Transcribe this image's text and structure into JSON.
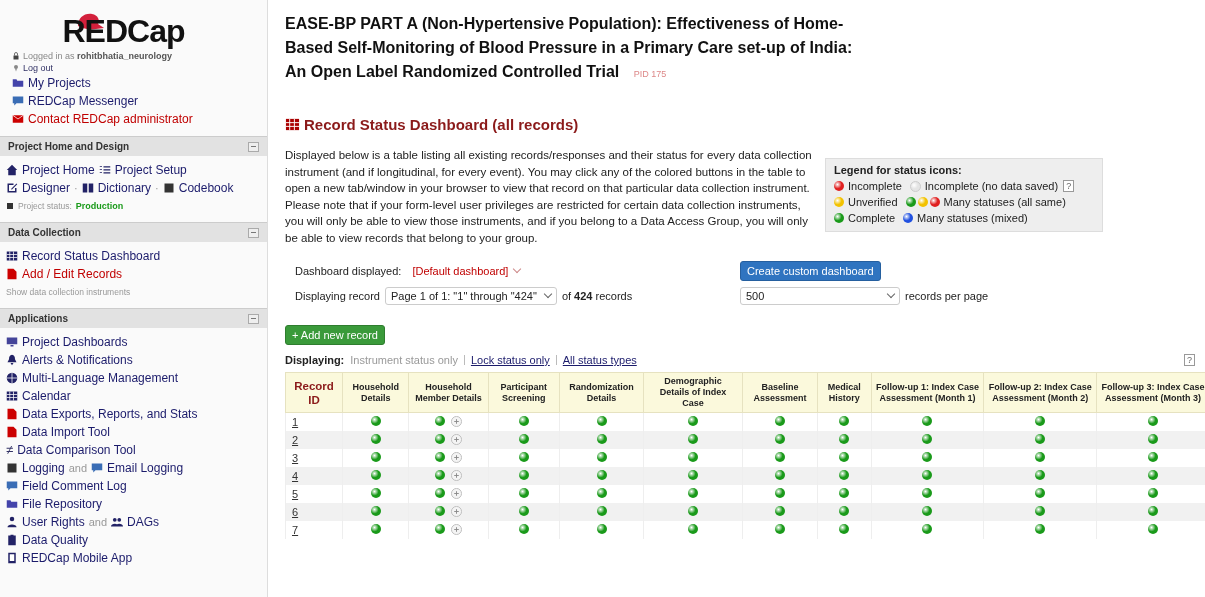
{
  "sidebar": {
    "logo": "REDCap",
    "login": {
      "prefix": "Logged in as",
      "user": "rohitbhatia_neurology",
      "logout": "Log out"
    },
    "links": [
      {
        "label": "My Projects",
        "kind": "link"
      },
      {
        "label": "REDCap Messenger",
        "kind": "link"
      },
      {
        "label": "Contact REDCap administrator",
        "kind": "red-link"
      }
    ],
    "sections": [
      {
        "title": "Project Home and Design",
        "expanded": true,
        "rows": [
          [
            {
              "label": "Project Home",
              "kind": "link"
            },
            {
              "label": "Project Setup",
              "kind": "link"
            }
          ],
          [
            {
              "label": "Designer",
              "kind": "link"
            },
            {
              "label": "·",
              "kind": "text"
            },
            {
              "label": "Dictionary",
              "kind": "link"
            },
            {
              "label": "·",
              "kind": "text"
            },
            {
              "label": "Codebook",
              "kind": "link"
            }
          ],
          [
            {
              "label": "Project status:",
              "kind": "note"
            },
            {
              "label": "Production",
              "kind": "status"
            }
          ]
        ]
      },
      {
        "title": "Data Collection",
        "expanded": true,
        "rows": [
          [
            {
              "label": "Record Status Dashboard",
              "kind": "link"
            }
          ],
          [
            {
              "label": "Add / Edit Records",
              "kind": "red-link"
            }
          ],
          [
            {
              "label": "Show data collection instruments",
              "kind": "note"
            }
          ]
        ]
      },
      {
        "title": "Applications",
        "expanded": true,
        "rows": [
          [
            {
              "label": "Project Dashboards",
              "kind": "link"
            }
          ],
          [
            {
              "label": "Alerts & Notifications",
              "kind": "link"
            }
          ],
          [
            {
              "label": "Multi-Language Management",
              "kind": "link"
            }
          ],
          [
            {
              "label": "Calendar",
              "kind": "link"
            }
          ],
          [
            {
              "label": "Data Exports, Reports, and Stats",
              "kind": "link"
            }
          ],
          [
            {
              "label": "Data Import Tool",
              "kind": "link"
            }
          ],
          [
            {
              "label": "≠",
              "kind": "glyph"
            },
            {
              "label": "Data Comparison Tool",
              "kind": "link"
            }
          ],
          [
            {
              "label": "Logging",
              "kind": "link"
            },
            {
              "label": "and",
              "kind": "text"
            },
            {
              "label": "Email Logging",
              "kind": "link"
            }
          ],
          [
            {
              "label": "Field Comment Log",
              "kind": "link"
            }
          ],
          [
            {
              "label": "File Repository",
              "kind": "link"
            }
          ],
          [
            {
              "label": "User Rights",
              "kind": "link"
            },
            {
              "label": "and",
              "kind": "text"
            },
            {
              "label": "DAGs",
              "kind": "link"
            }
          ],
          [
            {
              "label": "Data Quality",
              "kind": "link"
            }
          ],
          [
            {
              "label": "REDCap Mobile App",
              "kind": "link"
            }
          ]
        ]
      }
    ]
  },
  "project": {
    "title": "EASE-BP PART A (Non-Hypertensive Population): Effectiveness of Home-Based Self-Monitoring of Blood Pressure in a Primary Care set-up of India: An Open Label Randomized Controlled Trial",
    "pid": "PID 175"
  },
  "page_heading": "Record Status Dashboard (all records)",
  "description": "Displayed below is a table listing all existing records/responses and their status for every data collection instrument (and if longitudinal, for every event). You may click any of the colored buttons in the table to open a new tab/window in your browser to view that record on that particular data collection instrument. Please note that if your form-level user privileges are restricted for certain data collection instruments, you will only be able to view those instruments, and if you belong to a Data Access Group, you will only be able to view records that belong to your group.",
  "legend": {
    "title": "Legend for status icons:",
    "rows": [
      [
        {
          "statuses": [
            {
              "kind": "incomplete"
            }
          ],
          "label": "Incomplete"
        },
        {
          "statuses": [
            {
              "kind": "empty"
            }
          ],
          "label": "Incomplete (no data saved)",
          "help": "?"
        }
      ],
      [
        {
          "statuses": [
            {
              "kind": "unverified"
            }
          ],
          "label": "Unverified"
        },
        {
          "statuses": [
            {
              "kind": "complete"
            },
            {
              "kind": "unverified"
            },
            {
              "kind": "incomplete"
            }
          ],
          "label": "Many statuses (all same)"
        }
      ],
      [
        {
          "statuses": [
            {
              "kind": "complete"
            }
          ],
          "label": "Complete"
        },
        {
          "statuses": [
            {
              "kind": "mixed"
            }
          ],
          "label": "Many statuses (mixed)"
        }
      ]
    ]
  },
  "controls": {
    "dashboard_label": "Dashboard displayed:",
    "dashboard_select": "[Default dashboard]",
    "create_button": "Create custom dashboard",
    "record_label": "Displaying record",
    "page_select": "Page 1 of 1: \"1\" through \"424\"",
    "record_count": "of **424** records",
    "per_page_select": "500",
    "per_page_label": "records per page"
  },
  "add_button": "+ Add new record",
  "display": {
    "label": "Displaying:",
    "options": [
      {
        "label": "Instrument status only",
        "selected": true
      },
      {
        "label": "Lock status only",
        "selected": false
      },
      {
        "label": "All status types",
        "selected": false
      }
    ],
    "help": "?"
  },
  "table": {
    "columns": [
      {
        "label": "Record ID",
        "kind": "id"
      },
      {
        "label": "Household Details",
        "kind": "instrument"
      },
      {
        "label": "Household Member Details",
        "kind": "repeating"
      },
      {
        "label": "Participant Screening",
        "kind": "instrument"
      },
      {
        "label": "Randomization Details",
        "kind": "instrument"
      },
      {
        "label": "Demographic Details of Index Case",
        "kind": "instrument"
      },
      {
        "label": "Baseline Assessment",
        "kind": "instrument"
      },
      {
        "label": "Medical History",
        "kind": "instrument"
      },
      {
        "label": "Follow-up 1: Index Case Assessment (Month 1)",
        "kind": "instrument"
      },
      {
        "label": "Follow-up 2: Index Case Assessment (Month 2)",
        "kind": "instrument"
      },
      {
        "label": "Follow-up 3: Index Case Assessment (Month 3)",
        "kind": "instrument"
      }
    ],
    "rows": [
      {
        "id": "1",
        "cells": [
          {
            "kind": "complete"
          },
          {
            "kind": "complete"
          },
          {
            "kind": "complete"
          },
          {
            "kind": "complete"
          },
          {
            "kind": "complete"
          },
          {
            "kind": "complete"
          },
          {
            "kind": "complete"
          },
          {
            "kind": "complete"
          },
          {
            "kind": "complete"
          },
          {
            "kind": "complete"
          }
        ]
      },
      {
        "id": "2",
        "cells": [
          {
            "kind": "complete"
          },
          {
            "kind": "complete"
          },
          {
            "kind": "complete"
          },
          {
            "kind": "complete"
          },
          {
            "kind": "complete"
          },
          {
            "kind": "complete"
          },
          {
            "kind": "complete"
          },
          {
            "kind": "complete"
          },
          {
            "kind": "complete"
          },
          {
            "kind": "complete"
          }
        ]
      },
      {
        "id": "3",
        "cells": [
          {
            "kind": "complete"
          },
          {
            "kind": "complete"
          },
          {
            "kind": "complete"
          },
          {
            "kind": "complete"
          },
          {
            "kind": "complete"
          },
          {
            "kind": "complete"
          },
          {
            "kind": "complete"
          },
          {
            "kind": "complete"
          },
          {
            "kind": "complete"
          },
          {
            "kind": "complete"
          }
        ]
      },
      {
        "id": "4",
        "cells": [
          {
            "kind": "complete"
          },
          {
            "kind": "complete"
          },
          {
            "kind": "complete"
          },
          {
            "kind": "complete"
          },
          {
            "kind": "complete"
          },
          {
            "kind": "complete"
          },
          {
            "kind": "complete"
          },
          {
            "kind": "complete"
          },
          {
            "kind": "complete"
          },
          {
            "kind": "complete"
          }
        ]
      },
      {
        "id": "5",
        "cells": [
          {
            "kind": "complete"
          },
          {
            "kind": "complete"
          },
          {
            "kind": "complete"
          },
          {
            "kind": "complete"
          },
          {
            "kind": "complete"
          },
          {
            "kind": "complete"
          },
          {
            "kind": "complete"
          },
          {
            "kind": "complete"
          },
          {
            "kind": "complete"
          },
          {
            "kind": "complete"
          }
        ]
      },
      {
        "id": "6",
        "cells": [
          {
            "kind": "complete"
          },
          {
            "kind": "complete"
          },
          {
            "kind": "complete"
          },
          {
            "kind": "complete"
          },
          {
            "kind": "complete"
          },
          {
            "kind": "complete"
          },
          {
            "kind": "complete"
          },
          {
            "kind": "complete"
          },
          {
            "kind": "complete"
          },
          {
            "kind": "complete"
          }
        ]
      },
      {
        "id": "7",
        "cells": [
          {
            "kind": "complete"
          },
          {
            "kind": "complete"
          },
          {
            "kind": "complete"
          },
          {
            "kind": "complete"
          },
          {
            "kind": "complete"
          },
          {
            "kind": "complete"
          },
          {
            "kind": "complete"
          },
          {
            "kind": "complete"
          },
          {
            "kind": "complete"
          },
          {
            "kind": "complete"
          }
        ]
      }
    ]
  }
}
